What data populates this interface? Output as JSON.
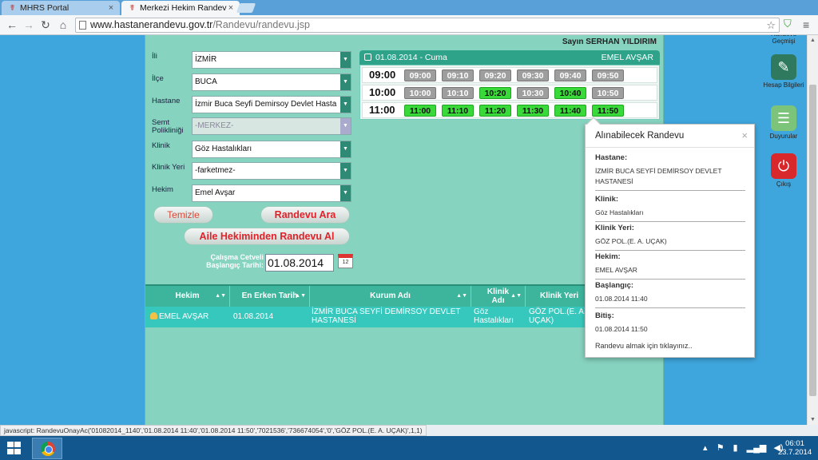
{
  "browser": {
    "tabs": [
      {
        "title": "MHRS Portal",
        "active": false
      },
      {
        "title": "Merkezi Hekim Randevu S",
        "active": true
      }
    ],
    "url_host": "www.hastanerandevu.gov.tr",
    "url_path": "/Randevu/randevu.jsp"
  },
  "header": {
    "greeting": "Sayın SERHAN YILDIRIM"
  },
  "form": [
    {
      "label": "İli",
      "value": "İZMİR",
      "disabled": false
    },
    {
      "label": "İlçe",
      "value": "BUCA",
      "disabled": false
    },
    {
      "label": "Hastane",
      "value": "İzmir Buca Seyfi Demirsoy Devlet Hasta",
      "disabled": false
    },
    {
      "label": "Semt Polikliniği",
      "value": "-MERKEZ-",
      "disabled": true
    },
    {
      "label": "Klinik",
      "value": "Göz Hastalıkları",
      "disabled": false
    },
    {
      "label": "Klinik Yeri",
      "value": "-farketmez-",
      "disabled": false
    },
    {
      "label": "Hekim",
      "value": "Emel Avşar",
      "disabled": false
    }
  ],
  "buttons": {
    "clear": "Temizle",
    "search": "Randevu Ara",
    "family": "Aile Hekiminden Randevu Al"
  },
  "date_field": {
    "label": "Çalışma Cetveli Başlangıç Tarihi:",
    "value": "01.08.2014"
  },
  "timetable": {
    "date": "01.08.2014 - Cuma",
    "doctor": "EMEL AVŞAR",
    "rows": [
      {
        "hour": "09:00",
        "slots": [
          {
            "t": "09:00",
            "free": false
          },
          {
            "t": "09:10",
            "free": false
          },
          {
            "t": "09:20",
            "free": false
          },
          {
            "t": "09:30",
            "free": false
          },
          {
            "t": "09:40",
            "free": false
          },
          {
            "t": "09:50",
            "free": false
          }
        ]
      },
      {
        "hour": "10:00",
        "slots": [
          {
            "t": "10:00",
            "free": false
          },
          {
            "t": "10:10",
            "free": false
          },
          {
            "t": "10:20",
            "free": true
          },
          {
            "t": "10:30",
            "free": false
          },
          {
            "t": "10:40",
            "free": true
          },
          {
            "t": "10:50",
            "free": false
          }
        ]
      },
      {
        "hour": "11:00",
        "slots": [
          {
            "t": "11:00",
            "free": true
          },
          {
            "t": "11:10",
            "free": true
          },
          {
            "t": "11:20",
            "free": true
          },
          {
            "t": "11:30",
            "free": true
          },
          {
            "t": "11:40",
            "free": true
          },
          {
            "t": "11:50",
            "free": true
          }
        ]
      }
    ]
  },
  "results": {
    "columns": [
      "Hekim",
      "En Erken Tarih",
      "Kurum Adı",
      "Klinik Adı",
      "Klinik Yeri"
    ],
    "row": {
      "hekim": "EMEL AVŞAR",
      "tarih": "01.08.2014",
      "kurum": "İZMİR BUCA SEYFİ DEMİRSOY DEVLET HASTANESİ",
      "klinik": "Göz Hastalıkları",
      "yer": "GÖZ POL.(E. A. UÇAK)"
    }
  },
  "popup": {
    "title": "Alınabilecek Randevu",
    "fields": [
      {
        "label": "Hastane:",
        "value": "İZMİR BUCA SEYFİ DEMİRSOY DEVLET HASTANESİ"
      },
      {
        "label": "Klinik:",
        "value": "Göz Hastalıkları"
      },
      {
        "label": "Klinik Yeri:",
        "value": "GÖZ POL.(E. A. UÇAK)"
      },
      {
        "label": "Hekim:",
        "value": "EMEL AVŞAR"
      },
      {
        "label": "Başlangıç:",
        "value": "01.08.2014 11:40"
      },
      {
        "label": "Bitiş:",
        "value": "01.08.2014 11:50"
      }
    ],
    "link": "Randevu almak için tıklayınız.."
  },
  "side_nav": [
    {
      "label": "Randevu Geçmişi",
      "icon": "history-icon",
      "color": "#6fb36a"
    },
    {
      "label": "Hesap Bilgileri",
      "icon": "account-icon",
      "color": "#2f7a5f"
    },
    {
      "label": "Duyurular",
      "icon": "announcement-icon",
      "color": "#7cc47a"
    },
    {
      "label": "Çıkış",
      "icon": "power-icon",
      "color": "#d9282b"
    }
  ],
  "status_text": "javascript: RandevuOnayAc('01082014_1140','01.08.2014 11:40','01.08.2014 11:50','7021536','736674054','0','GÖZ POL.(E. A. UÇAK)',1,1)",
  "clock": {
    "time": "06:01",
    "date": "23.7.2014"
  }
}
